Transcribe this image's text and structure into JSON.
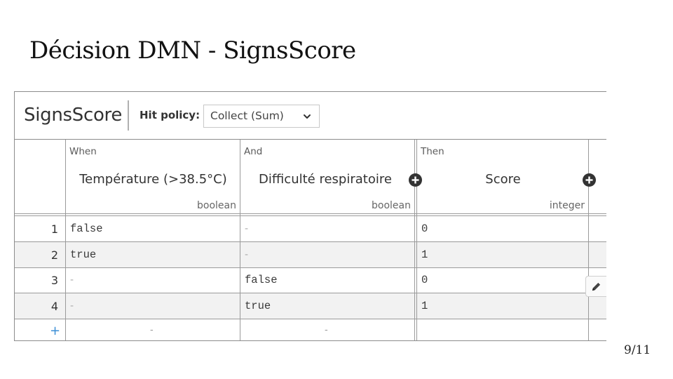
{
  "slide": {
    "title": "Décision DMN - SignsScore",
    "page_number": "9/11"
  },
  "dmn": {
    "decision_name": "SignsScore",
    "hit_policy_label": "Hit policy:",
    "hit_policy_value": "Collect (Sum)",
    "columns": [
      {
        "kind": "When",
        "label": "Température (>38.5°C)",
        "type": "boolean"
      },
      {
        "kind": "And",
        "label": "Difficulté respiratoire",
        "type": "boolean"
      },
      {
        "kind": "Then",
        "label": "Score",
        "type": "integer"
      }
    ],
    "rows": [
      {
        "index": "1",
        "cells": [
          "false",
          "-",
          "0"
        ]
      },
      {
        "index": "2",
        "cells": [
          "true",
          "-",
          "1"
        ]
      },
      {
        "index": "3",
        "cells": [
          "-",
          "false",
          "0"
        ]
      },
      {
        "index": "4",
        "cells": [
          "-",
          "true",
          "1"
        ]
      }
    ],
    "add_row_symbol": "+",
    "empty_row_cells": [
      "-",
      "-",
      ""
    ]
  },
  "icons": {
    "add_input_column": "plus-circle-icon",
    "add_output_column": "plus-circle-icon",
    "hit_policy_dropdown": "chevron-down-icon",
    "edit": "pencil-icon"
  }
}
